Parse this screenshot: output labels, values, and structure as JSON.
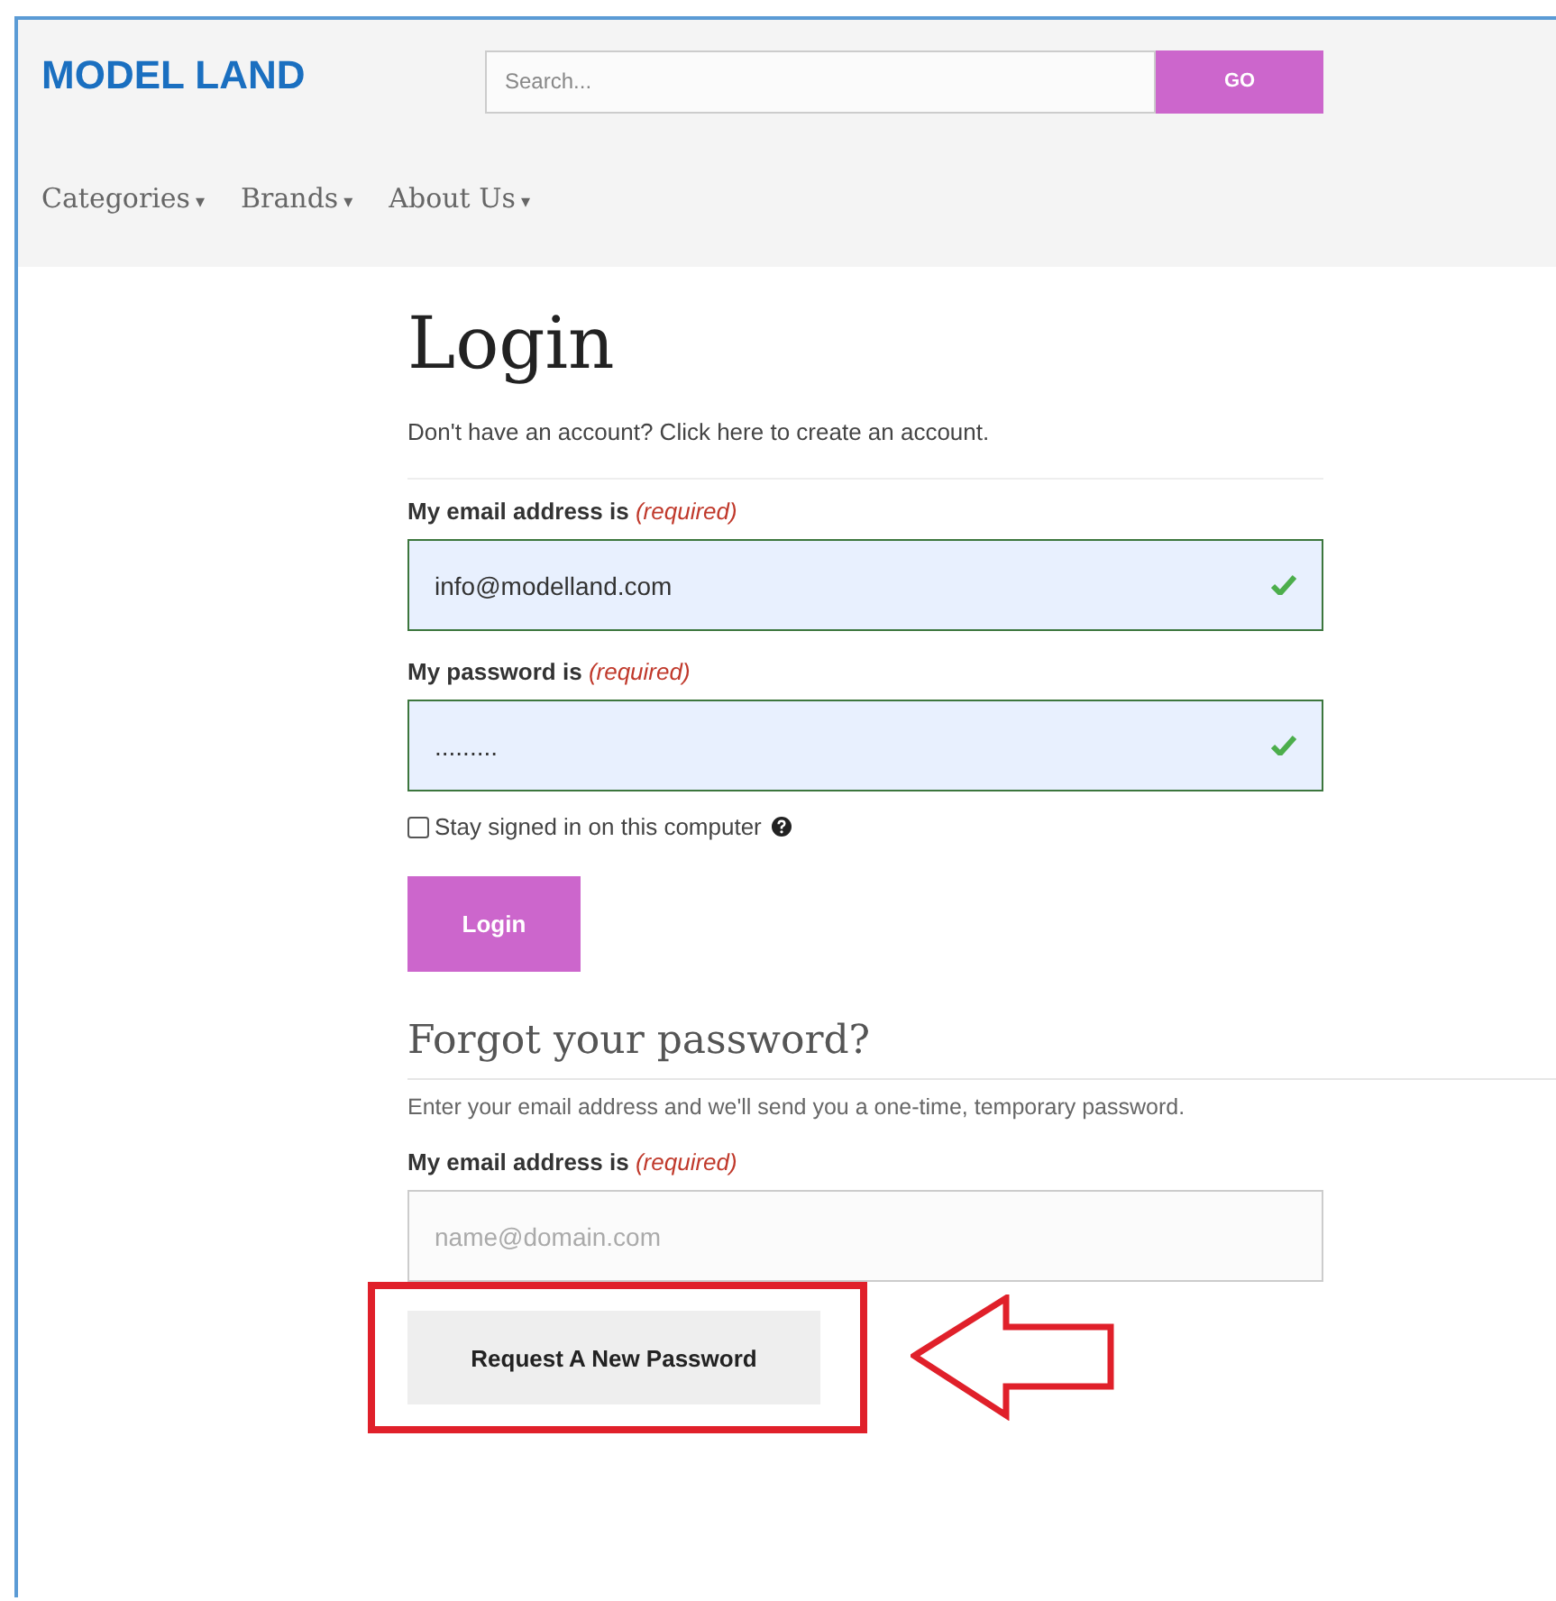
{
  "header": {
    "logo": "MODEL LAND",
    "search": {
      "placeholder": "Search..."
    },
    "go_button": "GO"
  },
  "nav": [
    {
      "label": "Categories",
      "caret": "▾"
    },
    {
      "label": "Brands",
      "caret": "▾"
    },
    {
      "label": "About Us",
      "caret": "▾"
    }
  ],
  "login": {
    "title": "Login",
    "intro": "Don't have an account? Click here to create an account.",
    "fields": [
      {
        "label": "My email address is",
        "required": "(required)",
        "value": "info@modelland.com",
        "valid": true
      },
      {
        "label": "My password is",
        "required": "(required)",
        "value": ".........",
        "valid": true
      }
    ],
    "remember": {
      "label": "Stay signed in on this computer",
      "checked": false
    },
    "button": "Login"
  },
  "forgot": {
    "title": "Forgot your password?",
    "intro": "Enter your email address and we'll send you a one-time, temporary password.",
    "field": {
      "label": "My email address is",
      "required": "(required)",
      "placeholder": "name@domain.com"
    },
    "button": "Request A New Password"
  }
}
